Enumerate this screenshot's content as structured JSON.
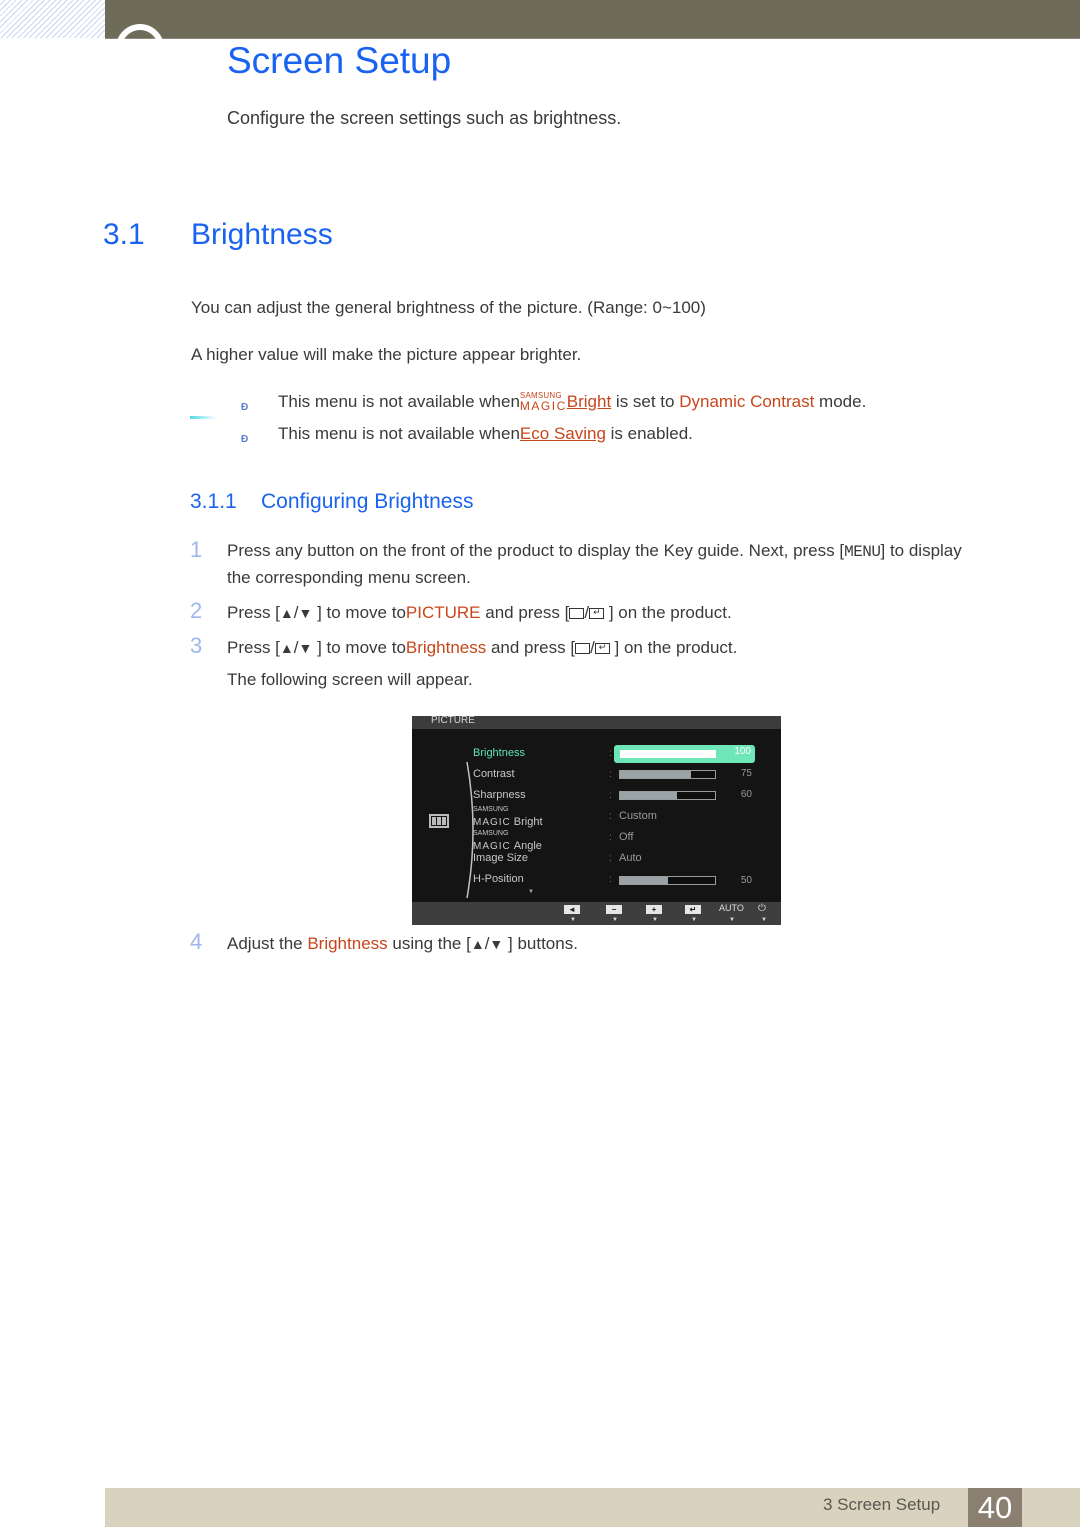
{
  "header": {
    "chapter_title": "Screen Setup",
    "chapter_subtitle": "Configure the screen settings such as brightness."
  },
  "section": {
    "number": "3.1",
    "title": "Brightness",
    "paragraphs": [
      "You can adjust the general brightness of the picture. (Range: 0~100)",
      "A higher value will make the picture appear brighter."
    ],
    "notes": [
      {
        "bullet": "Đ",
        "prefix": "This menu is not available when",
        "magic_small": "SAMSUNG",
        "magic_large": "MAGIC",
        "link": "Bright",
        "middle": " is set to ",
        "link2": "Dynamic Contrast",
        "suffix": " mode."
      },
      {
        "bullet": "Đ",
        "prefix": "This menu is not available when",
        "link": "Eco Saving",
        "suffix": " is enabled."
      }
    ]
  },
  "subsection": {
    "number": "3.1.1",
    "title": "Configuring Brightness",
    "steps": [
      {
        "num": "1",
        "line1_a": "Press any button on the front of the product to display the Key guide. Next, press [",
        "key": "MENU",
        "line1_b": "] to display",
        "line2": "the corresponding menu screen."
      },
      {
        "num": "2",
        "a": "Press [",
        "up": "▲",
        "slash": "/",
        "down": "▼",
        "b": " ] to move to",
        "target": "PICTURE",
        "c": " and press [",
        "d": " ] on the product."
      },
      {
        "num": "3",
        "a": "Press [",
        "up": "▲",
        "slash": "/",
        "down": "▼",
        "b": " ] to move to",
        "target": "Brightness",
        "c": "  and press [",
        "d": " ] on the product.",
        "after": "The following screen will appear."
      },
      {
        "num": "4",
        "a": "Adjust the ",
        "target": "Brightness",
        "b": "  using the [",
        "up": "▲",
        "slash": "/",
        "down": "▼",
        "c": " ] buttons."
      }
    ]
  },
  "osd": {
    "title": "PICTURE",
    "items": [
      {
        "label": "Brightness",
        "value": "100",
        "level": 100,
        "active": true
      },
      {
        "label": "Contrast",
        "value": "75",
        "level": 75
      },
      {
        "label": "Sharpness",
        "value": "60",
        "level": 60
      },
      {
        "magic_small": "SAMSUNG",
        "magic_large": "MAGIC",
        "label": "Bright",
        "value": "Custom"
      },
      {
        "magic_small": "SAMSUNG",
        "magic_large": "MAGIC",
        "label": "Angle",
        "value": "Off"
      },
      {
        "label": "Image Size",
        "value": "Auto"
      },
      {
        "label": "H-Position",
        "value": "50",
        "level": 50
      }
    ],
    "colon": ":",
    "more_indicator": "▼",
    "buttons": [
      {
        "icon": "left-arrow-icon",
        "glyph": "◄"
      },
      {
        "icon": "minus-icon",
        "glyph": "−"
      },
      {
        "icon": "plus-icon",
        "glyph": "+"
      },
      {
        "icon": "enter-icon",
        "glyph": "↵"
      },
      {
        "icon": "auto-label",
        "text": "AUTO"
      },
      {
        "icon": "power-icon",
        "glyph": "⏻"
      }
    ],
    "button_arrow": "▼"
  },
  "footer": {
    "chapter_label": "3 Screen Setup",
    "page_number": "40"
  },
  "colors": {
    "heading_blue": "#1a63f0",
    "link_orange": "#c8461b",
    "osd_active": "#5ee6b2",
    "header_bar": "#6e6c59",
    "footer_bar": "#d9d2be",
    "footer_page": "#8b7f72"
  }
}
